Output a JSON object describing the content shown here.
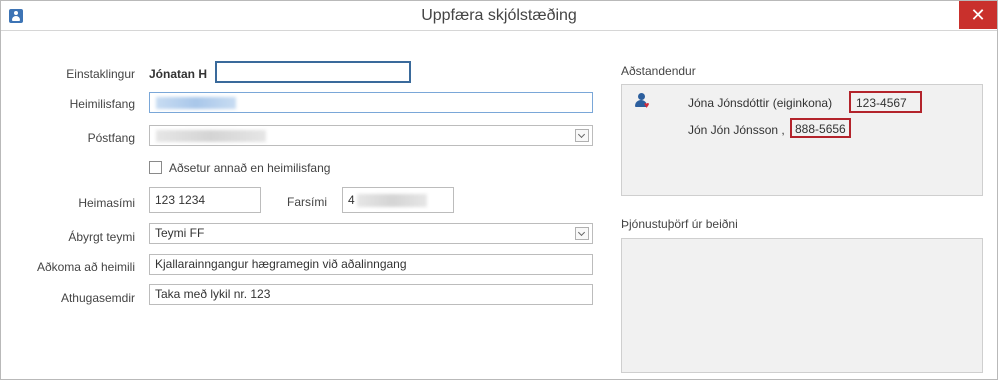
{
  "window": {
    "title": "Uppfæra skjólstæðing",
    "close_glyph": "✕"
  },
  "form": {
    "individual": {
      "label": "Einstaklingur",
      "value": "Jónatan H"
    },
    "address": {
      "label": "Heimilisfang"
    },
    "postal": {
      "label": "Póstfang"
    },
    "other_residence": {
      "label": "Aðsetur annað en heimilisfang",
      "checked": false
    },
    "home_phone": {
      "label": "Heimasími",
      "value": "123 1234"
    },
    "mobile": {
      "label": "Farsími",
      "value": "4"
    },
    "team": {
      "label": "Ábyrgt teymi",
      "value": "Teymi FF"
    },
    "access": {
      "label": "Aðkoma að heimili",
      "value": "Kjallarainngangur hægramegin við aðalinngang"
    },
    "notes": {
      "label": "Athugasemdir",
      "value": "Taka með lykil nr. 123"
    }
  },
  "relatives": {
    "heading": "Aðstandendur",
    "items": [
      {
        "name": "Jóna Jónsdóttir (eiginkona)",
        "phone": "123-4567"
      },
      {
        "name": "Jón Jón Jónsson ,",
        "phone": "888-5656"
      }
    ]
  },
  "service_needs": {
    "heading": "Þjónustuþörf úr beiðni"
  },
  "icons": {
    "app": "person-badge-icon",
    "relatives": "person-heart-icon",
    "close": "close-icon",
    "dropdown": "chevron-down-icon"
  },
  "colors": {
    "close_bg": "#c9302c",
    "highlight": "#b3232b",
    "focus": "#7aa7d8"
  }
}
